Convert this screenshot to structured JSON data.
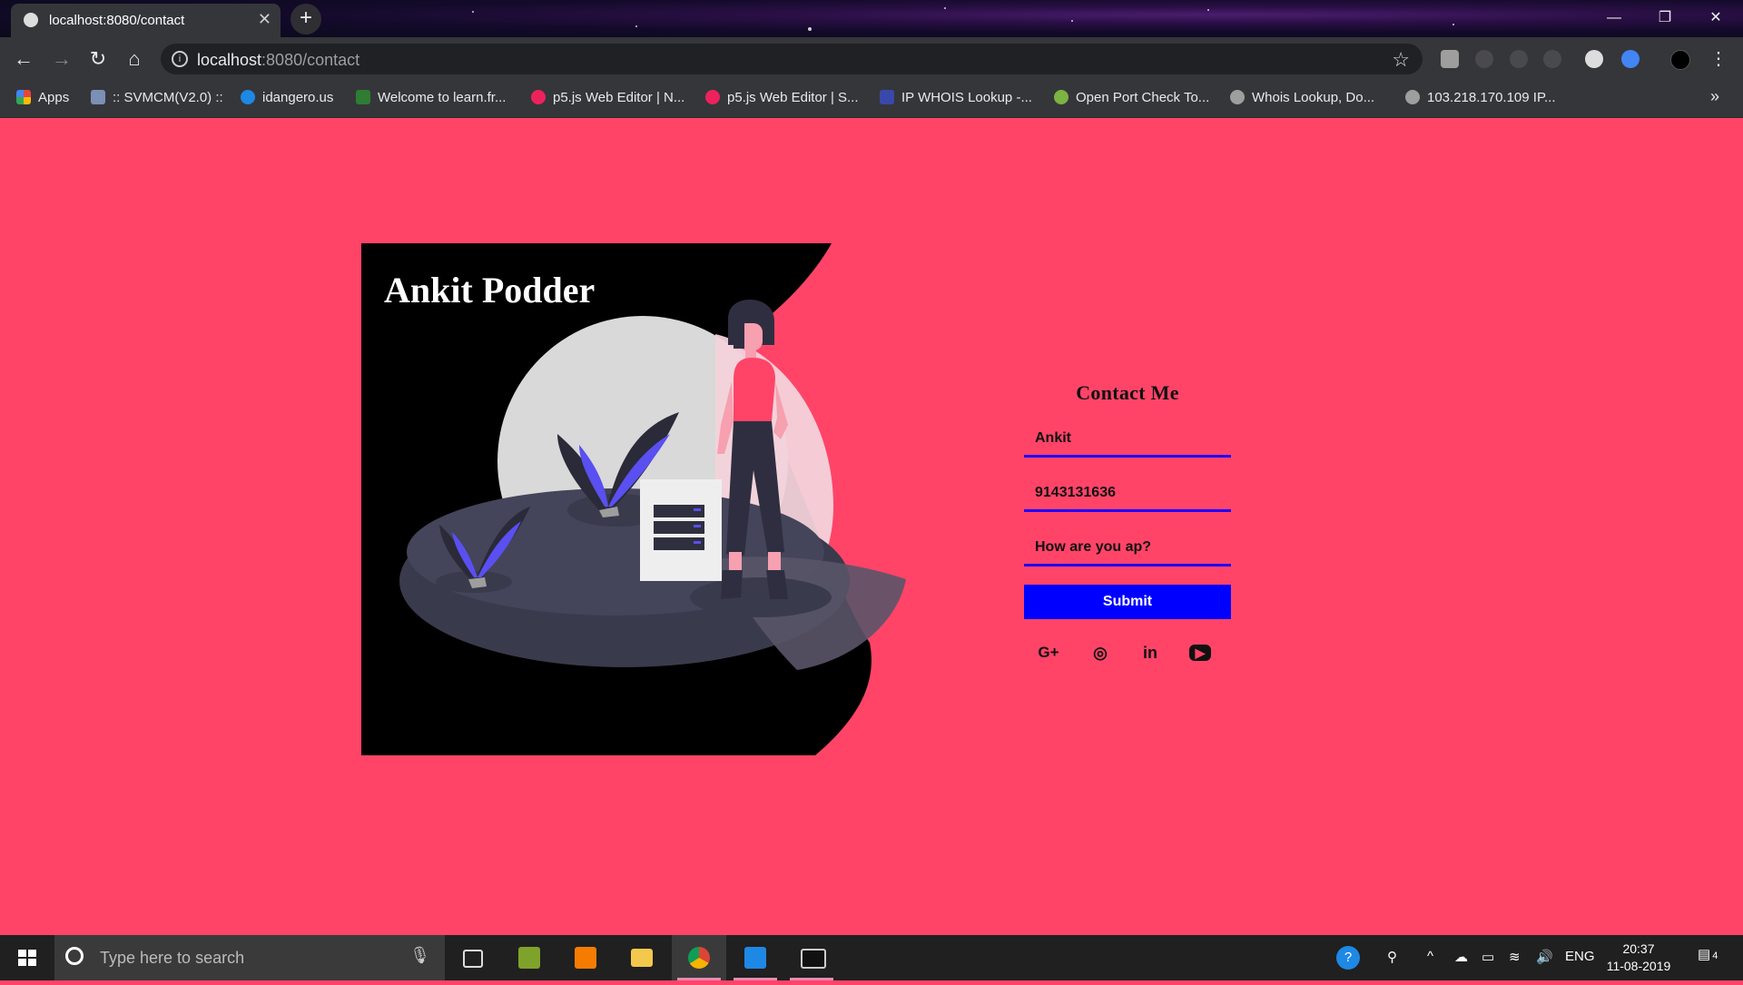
{
  "browser": {
    "tab": {
      "title": "localhost:8080/contact",
      "favicon": "globe-icon"
    },
    "new_tab_symbol": "+",
    "window_controls": {
      "minimize": "—",
      "restore": "❐",
      "close": "✕"
    },
    "toolbar": {
      "back": "←",
      "forward": "→",
      "reload": "↻",
      "home": "⌂"
    },
    "address": {
      "host": "localhost",
      "path": ":8080/contact",
      "info_symbol": "i",
      "bookmark_star": "☆"
    },
    "bookmarks": [
      {
        "label": "Apps",
        "icon": "apps-grid-icon",
        "color": "#e8453c"
      },
      {
        "label": ":: SVMCM(V2.0) ::",
        "icon": "graduation-cap-icon",
        "color": "#7c8fb5"
      },
      {
        "label": "idangero.us",
        "icon": "s-logo-icon",
        "color": "#1e88e5"
      },
      {
        "label": "Welcome to learn.fr...",
        "icon": "learn-icon",
        "color": "#2e7d32"
      },
      {
        "label": "p5.js Web Editor | N...",
        "icon": "asterisk-icon",
        "color": "#ed225d"
      },
      {
        "label": "p5.js Web Editor | S...",
        "icon": "asterisk-icon",
        "color": "#ed225d"
      },
      {
        "label": "IP WHOIS Lookup -...",
        "icon": "whois-icon",
        "color": "#3949ab"
      },
      {
        "label": "Open Port Check To...",
        "icon": "globe-icon",
        "color": "#7cb342"
      },
      {
        "label": "Whois Lookup, Do...",
        "icon": "gear-icon",
        "color": "#9e9e9e"
      },
      {
        "label": "103.218.170.109 IP...",
        "icon": "gear-icon",
        "color": "#9e9e9e"
      }
    ],
    "bookmarks_overflow": "»"
  },
  "hero": {
    "title": "Ankit Podder"
  },
  "contact": {
    "heading": "Contact Me",
    "name_value": "Ankit",
    "phone_value": "9143131636",
    "message_value": "How are you ap?",
    "submit_label": "Submit",
    "socials": [
      {
        "label": "G+",
        "icon": "google-plus-icon"
      },
      {
        "label": "◎",
        "icon": "instagram-icon"
      },
      {
        "label": "in",
        "icon": "linkedin-icon"
      },
      {
        "label": "▶",
        "icon": "youtube-icon"
      }
    ]
  },
  "taskbar": {
    "search_placeholder": "Type here to search",
    "apps": [
      {
        "icon": "task-view-icon",
        "color": "#202020"
      },
      {
        "icon": "lambda-app-icon",
        "color": "#7fa32a"
      },
      {
        "icon": "sublime-text-icon",
        "color": "#f57c00"
      },
      {
        "icon": "file-explorer-icon",
        "color": "#f2c94c"
      },
      {
        "icon": "chrome-icon",
        "color": "#db4437"
      },
      {
        "icon": "vscode-icon",
        "color": "#1e88e5"
      },
      {
        "icon": "terminal-icon",
        "color": "#111111"
      }
    ],
    "language": "ENG",
    "time": "20:37",
    "date": "11-08-2019",
    "notification_count": "4"
  },
  "colors": {
    "page_bg": "#ff4468",
    "accent_blue": "#0000ff",
    "underline": "#2200ff"
  }
}
